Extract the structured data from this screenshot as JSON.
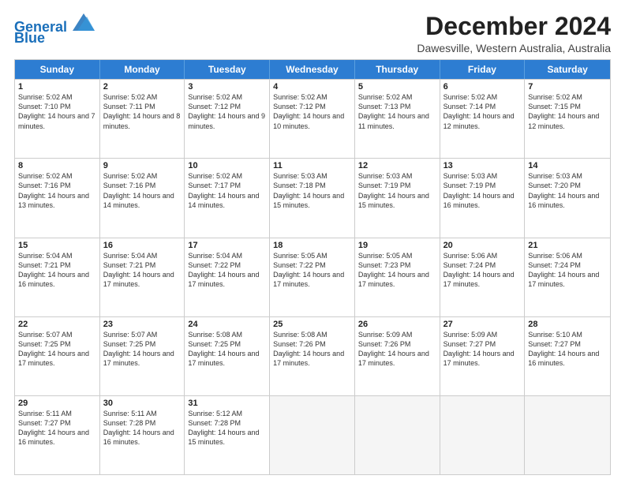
{
  "logo": {
    "line1": "General",
    "line2": "Blue"
  },
  "title": "December 2024",
  "location": "Dawesville, Western Australia, Australia",
  "header_days": [
    "Sunday",
    "Monday",
    "Tuesday",
    "Wednesday",
    "Thursday",
    "Friday",
    "Saturday"
  ],
  "weeks": [
    [
      {
        "day": 1,
        "sunrise": "5:02 AM",
        "sunset": "7:10 PM",
        "daylight": "14 hours and 7 minutes."
      },
      {
        "day": 2,
        "sunrise": "5:02 AM",
        "sunset": "7:11 PM",
        "daylight": "14 hours and 8 minutes."
      },
      {
        "day": 3,
        "sunrise": "5:02 AM",
        "sunset": "7:12 PM",
        "daylight": "14 hours and 9 minutes."
      },
      {
        "day": 4,
        "sunrise": "5:02 AM",
        "sunset": "7:12 PM",
        "daylight": "14 hours and 10 minutes."
      },
      {
        "day": 5,
        "sunrise": "5:02 AM",
        "sunset": "7:13 PM",
        "daylight": "14 hours and 11 minutes."
      },
      {
        "day": 6,
        "sunrise": "5:02 AM",
        "sunset": "7:14 PM",
        "daylight": "14 hours and 12 minutes."
      },
      {
        "day": 7,
        "sunrise": "5:02 AM",
        "sunset": "7:15 PM",
        "daylight": "14 hours and 12 minutes."
      }
    ],
    [
      {
        "day": 8,
        "sunrise": "5:02 AM",
        "sunset": "7:16 PM",
        "daylight": "14 hours and 13 minutes."
      },
      {
        "day": 9,
        "sunrise": "5:02 AM",
        "sunset": "7:16 PM",
        "daylight": "14 hours and 14 minutes."
      },
      {
        "day": 10,
        "sunrise": "5:02 AM",
        "sunset": "7:17 PM",
        "daylight": "14 hours and 14 minutes."
      },
      {
        "day": 11,
        "sunrise": "5:03 AM",
        "sunset": "7:18 PM",
        "daylight": "14 hours and 15 minutes."
      },
      {
        "day": 12,
        "sunrise": "5:03 AM",
        "sunset": "7:19 PM",
        "daylight": "14 hours and 15 minutes."
      },
      {
        "day": 13,
        "sunrise": "5:03 AM",
        "sunset": "7:19 PM",
        "daylight": "14 hours and 16 minutes."
      },
      {
        "day": 14,
        "sunrise": "5:03 AM",
        "sunset": "7:20 PM",
        "daylight": "14 hours and 16 minutes."
      }
    ],
    [
      {
        "day": 15,
        "sunrise": "5:04 AM",
        "sunset": "7:21 PM",
        "daylight": "14 hours and 16 minutes."
      },
      {
        "day": 16,
        "sunrise": "5:04 AM",
        "sunset": "7:21 PM",
        "daylight": "14 hours and 17 minutes."
      },
      {
        "day": 17,
        "sunrise": "5:04 AM",
        "sunset": "7:22 PM",
        "daylight": "14 hours and 17 minutes."
      },
      {
        "day": 18,
        "sunrise": "5:05 AM",
        "sunset": "7:22 PM",
        "daylight": "14 hours and 17 minutes."
      },
      {
        "day": 19,
        "sunrise": "5:05 AM",
        "sunset": "7:23 PM",
        "daylight": "14 hours and 17 minutes."
      },
      {
        "day": 20,
        "sunrise": "5:06 AM",
        "sunset": "7:24 PM",
        "daylight": "14 hours and 17 minutes."
      },
      {
        "day": 21,
        "sunrise": "5:06 AM",
        "sunset": "7:24 PM",
        "daylight": "14 hours and 17 minutes."
      }
    ],
    [
      {
        "day": 22,
        "sunrise": "5:07 AM",
        "sunset": "7:25 PM",
        "daylight": "14 hours and 17 minutes."
      },
      {
        "day": 23,
        "sunrise": "5:07 AM",
        "sunset": "7:25 PM",
        "daylight": "14 hours and 17 minutes."
      },
      {
        "day": 24,
        "sunrise": "5:08 AM",
        "sunset": "7:25 PM",
        "daylight": "14 hours and 17 minutes."
      },
      {
        "day": 25,
        "sunrise": "5:08 AM",
        "sunset": "7:26 PM",
        "daylight": "14 hours and 17 minutes."
      },
      {
        "day": 26,
        "sunrise": "5:09 AM",
        "sunset": "7:26 PM",
        "daylight": "14 hours and 17 minutes."
      },
      {
        "day": 27,
        "sunrise": "5:09 AM",
        "sunset": "7:27 PM",
        "daylight": "14 hours and 17 minutes."
      },
      {
        "day": 28,
        "sunrise": "5:10 AM",
        "sunset": "7:27 PM",
        "daylight": "14 hours and 16 minutes."
      }
    ],
    [
      {
        "day": 29,
        "sunrise": "5:11 AM",
        "sunset": "7:27 PM",
        "daylight": "14 hours and 16 minutes."
      },
      {
        "day": 30,
        "sunrise": "5:11 AM",
        "sunset": "7:28 PM",
        "daylight": "14 hours and 16 minutes."
      },
      {
        "day": 31,
        "sunrise": "5:12 AM",
        "sunset": "7:28 PM",
        "daylight": "14 hours and 15 minutes."
      },
      null,
      null,
      null,
      null
    ]
  ]
}
